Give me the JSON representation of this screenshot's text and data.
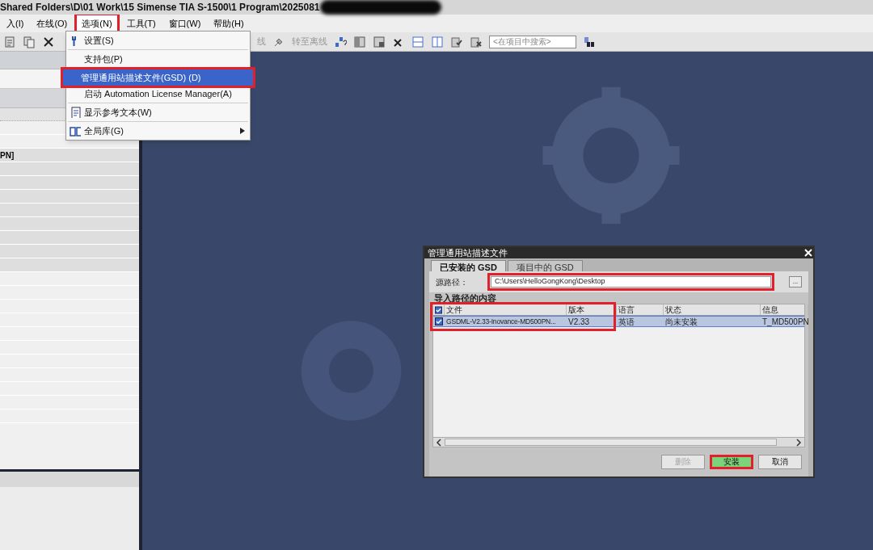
{
  "window": {
    "title": "Shared Folders\\D\\01 Work\\15 Simense TIA S-1500\\1 Program\\2025081"
  },
  "menu_bar": [
    {
      "label": "入(I)",
      "highlighted": false
    },
    {
      "label": "在线(O)",
      "highlighted": false
    },
    {
      "label": "选项(N)",
      "highlighted": true
    },
    {
      "label": "工具(T)",
      "highlighted": false
    },
    {
      "label": "窗口(W)",
      "highlighted": false
    },
    {
      "label": "帮助(H)",
      "highlighted": false
    }
  ],
  "toolbar": {
    "partial_label": "线",
    "offline_label": "转至离线",
    "search": {
      "placeholder": "<在项目中搜索>"
    }
  },
  "options_menu": [
    {
      "kind": "item",
      "label": "设置(S)",
      "selected": false,
      "highlighted": false,
      "submenu": false
    },
    {
      "kind": "separator"
    },
    {
      "kind": "item",
      "label": "支持包(P)",
      "selected": false,
      "highlighted": false,
      "submenu": false
    },
    {
      "kind": "separator"
    },
    {
      "kind": "item",
      "label": "管理通用站描述文件(GSD) (D)",
      "selected": true,
      "highlighted": true,
      "submenu": false
    },
    {
      "kind": "item",
      "label": "启动 Automation License Manager(A)",
      "selected": false,
      "highlighted": false,
      "submenu": false
    },
    {
      "kind": "separator"
    },
    {
      "kind": "item",
      "label": "显示参考文本(W)",
      "selected": false,
      "highlighted": false,
      "submenu": false
    },
    {
      "kind": "separator"
    },
    {
      "kind": "item",
      "label": "全局库(G)",
      "selected": false,
      "highlighted": false,
      "submenu": true
    }
  ],
  "left_panel": {
    "rows": [
      {
        "text": "PN]"
      }
    ]
  },
  "dialog": {
    "title": "管理通用站描述文件",
    "tabs": [
      {
        "label": "已安装的 GSD",
        "selected": true
      },
      {
        "label": "项目中的 GSD",
        "selected": false
      }
    ],
    "source_path": {
      "label": "源路径：",
      "value": "C:\\Users\\HelloGongKong\\Desktop",
      "highlighted": true,
      "browse": "..."
    },
    "section_title": "导入路径的内容",
    "table": {
      "highlighted": true,
      "select_all": {
        "checked": true
      },
      "columns": [
        {
          "label": "文件"
        },
        {
          "label": "版本"
        },
        {
          "label": "语言"
        },
        {
          "label": "状态"
        },
        {
          "label": "信息"
        }
      ],
      "rows": [
        {
          "checked": true,
          "selected": true,
          "cells": [
            "GSDML-V2.33-Inovance-MD500PN...",
            "V2.33",
            "英语",
            "尚未安装",
            "T_MD500PN"
          ]
        }
      ]
    },
    "buttons": [
      {
        "label": "删除",
        "disabled": true,
        "primary": false,
        "highlighted": false
      },
      {
        "label": "安装",
        "disabled": false,
        "primary": true,
        "highlighted": true
      },
      {
        "label": "取消",
        "disabled": false,
        "primary": false,
        "highlighted": false
      }
    ]
  }
}
